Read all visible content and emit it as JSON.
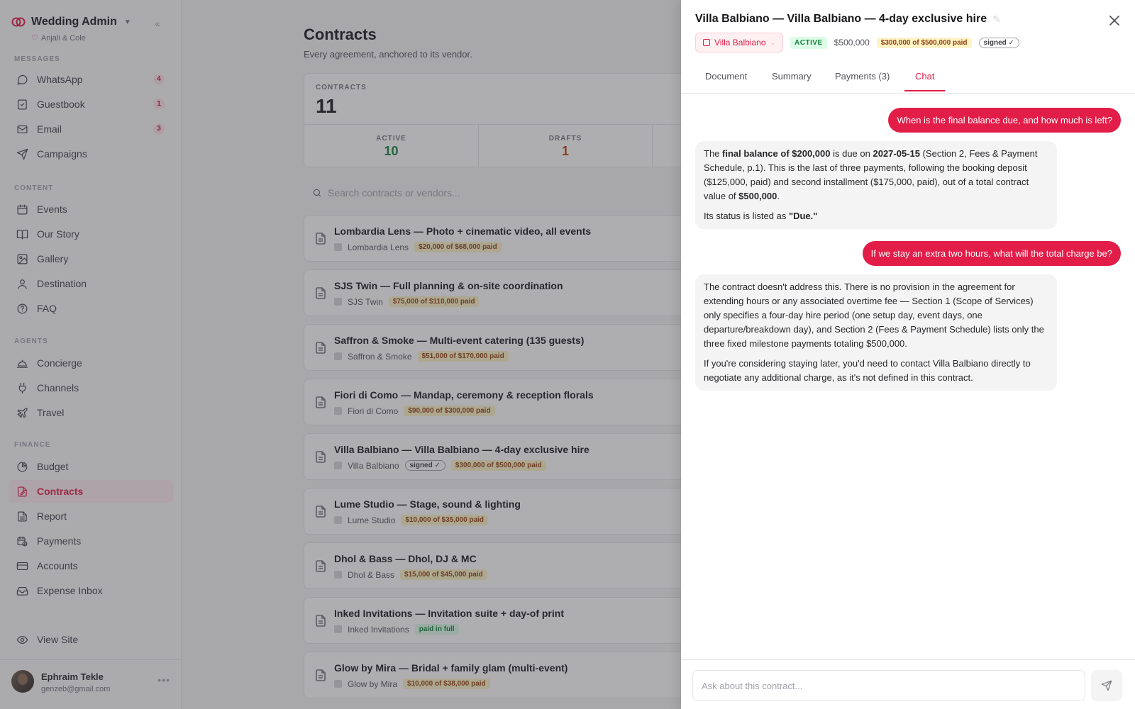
{
  "app": {
    "name": "Wedding Admin",
    "couple": "Anjali & Cole"
  },
  "sidebar": {
    "sections": [
      {
        "label": "MESSAGES",
        "items": [
          {
            "label": "WhatsApp",
            "icon": "message-circle-icon",
            "badge": "4"
          },
          {
            "label": "Guestbook",
            "icon": "guestbook-icon",
            "badge": "1"
          },
          {
            "label": "Email",
            "icon": "mail-icon",
            "badge": "3"
          },
          {
            "label": "Campaigns",
            "icon": "send-icon"
          }
        ]
      },
      {
        "label": "CONTENT",
        "items": [
          {
            "label": "Events",
            "icon": "calendar-icon"
          },
          {
            "label": "Our Story",
            "icon": "book-icon"
          },
          {
            "label": "Gallery",
            "icon": "image-icon"
          },
          {
            "label": "Destination",
            "icon": "map-pin-icon"
          },
          {
            "label": "FAQ",
            "icon": "help-circle-icon"
          }
        ]
      },
      {
        "label": "AGENTS",
        "items": [
          {
            "label": "Concierge",
            "icon": "bell-concierge-icon"
          },
          {
            "label": "Channels",
            "icon": "plug-icon"
          },
          {
            "label": "Travel",
            "icon": "plane-icon"
          }
        ]
      },
      {
        "label": "FINANCE",
        "items": [
          {
            "label": "Budget",
            "icon": "pie-chart-icon"
          },
          {
            "label": "Contracts",
            "icon": "file-signature-icon",
            "active": true
          },
          {
            "label": "Report",
            "icon": "file-text-icon"
          },
          {
            "label": "Payments",
            "icon": "calendar-clock-icon"
          },
          {
            "label": "Accounts",
            "icon": "credit-card-icon"
          },
          {
            "label": "Expense Inbox",
            "icon": "inbox-icon"
          }
        ]
      }
    ],
    "view_site": "View Site",
    "user": {
      "name": "Ephraim Tekle",
      "email": "genzeb@gmail.com"
    }
  },
  "page": {
    "title": "Contracts",
    "subtitle": "Every agreement, anchored to its vendor.",
    "stats": {
      "total_label": "CONTRACTS",
      "total": "11",
      "active_label": "ACTIVE",
      "active": "10",
      "drafts_label": "DRAFTS",
      "drafts": "1"
    },
    "search_placeholder": "Search contracts or vendors...",
    "contracts": [
      {
        "title": "Lombardia Lens — Photo + cinematic video, all events",
        "vendor": "Lombardia Lens",
        "paid": "$20,000 of $68,000 paid"
      },
      {
        "title": "SJS Twin — Full planning & on-site coordination",
        "vendor": "SJS Twin",
        "paid": "$75,000 of $110,000 paid"
      },
      {
        "title": "Saffron & Smoke — Multi-event catering (135 guests)",
        "vendor": "Saffron & Smoke",
        "paid": "$51,000 of $170,000 paid"
      },
      {
        "title": "Fiori di Como — Mandap, ceremony & reception florals",
        "vendor": "Fiori di Como",
        "paid": "$90,000 of $300,000 paid"
      },
      {
        "title": "Villa Balbiano — Villa Balbiano — 4-day exclusive hire",
        "vendor": "Villa Balbiano",
        "signed": "signed ✓",
        "paid": "$300,000 of $500,000 paid"
      },
      {
        "title": "Lume Studio — Stage, sound & lighting",
        "vendor": "Lume Studio",
        "paid": "$10,000 of $35,000 paid"
      },
      {
        "title": "Dhol & Bass — Dhol, DJ & MC",
        "vendor": "Dhol & Bass",
        "paid": "$15,000 of $45,000 paid"
      },
      {
        "title": "Inked Invitations — Invitation suite + day-of print",
        "vendor": "Inked Invitations",
        "paid_full": "paid in full"
      },
      {
        "title": "Glow by Mira — Bridal + family glam (multi-event)",
        "vendor": "Glow by Mira",
        "paid": "$10,000 of $38,000 paid"
      }
    ]
  },
  "drawer": {
    "title": "Villa Balbiano — Villa Balbiano — 4-day exclusive hire",
    "vendor": "Villa Balbiano",
    "status": "ACTIVE",
    "amount": "$500,000",
    "paid": "$300,000 of $500,000 paid",
    "signed": "signed ✓",
    "tabs": [
      "Document",
      "Summary",
      "Payments (3)",
      "Chat"
    ],
    "active_tab": "Chat",
    "chat": {
      "q1": "When is the final balance due, and how much is left?",
      "a1": {
        "p1_a": "The ",
        "p1_b": "final balance of $200,000",
        "p1_c": " is due on ",
        "p1_d": "2027-05-15",
        "p1_e": " (Section 2, Fees & Payment Schedule, p.1). This is the last of three payments, following the booking deposit ($125,000, paid) and second installment ($175,000, paid), out of a total contract value of ",
        "p1_f": "$500,000",
        "p1_g": ".",
        "p2_a": "Its status is listed as ",
        "p2_b": "\"Due.\""
      },
      "q2": "If we stay an extra two hours, what will the total charge be?",
      "a2": {
        "p1": "The contract doesn't address this. There is no provision in the agreement for extending hours or any associated overtime fee — Section 1 (Scope of Services) only specifies a four-day hire period (one setup day, event days, one departure/breakdown day), and Section 2 (Fees & Payment Schedule) lists only the three fixed milestone payments totaling $500,000.",
        "p2": "If you're considering staying later, you'd need to contact Villa Balbiano directly to negotiate any additional charge, as it's not defined in this contract."
      }
    },
    "input_placeholder": "Ask about this contract..."
  },
  "colors": {
    "accent": "#e11d48",
    "active_green": "#15803d",
    "draft_orange": "#c2410c"
  }
}
